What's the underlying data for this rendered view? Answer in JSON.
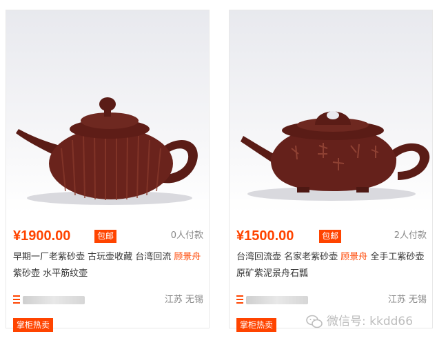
{
  "products": [
    {
      "image_alt": "early-factory zisha teapot with ribbed body",
      "currency": "¥",
      "price": "1900.00",
      "free_shipping": "包邮",
      "paid_count": "0人付款",
      "title_parts": [
        "早期一厂老紫砂壶 古玩壶收藏 台湾回流 ",
        "顾景舟",
        "紫砂壶 水平筋纹壶"
      ],
      "location": "江苏 无锡",
      "tag": "掌柜热卖"
    },
    {
      "image_alt": "zisha stone-ladle teapot with calligraphy",
      "currency": "¥",
      "price": "1500.00",
      "free_shipping": "包邮",
      "paid_count": "2人付款",
      "title_parts": [
        "台湾回流壶 名家老紫砂壶 ",
        "顾景舟",
        " 全手工紫砂壶 原矿紫泥景舟石瓢"
      ],
      "location": "江苏 无锡",
      "tag": "掌柜热卖"
    }
  ],
  "watermark": {
    "text": "微信号: kkdd66",
    "icon": "wechat-icon"
  },
  "colors": {
    "accent": "#ff4400",
    "teapot": "#6a231c",
    "muted": "#888888"
  }
}
